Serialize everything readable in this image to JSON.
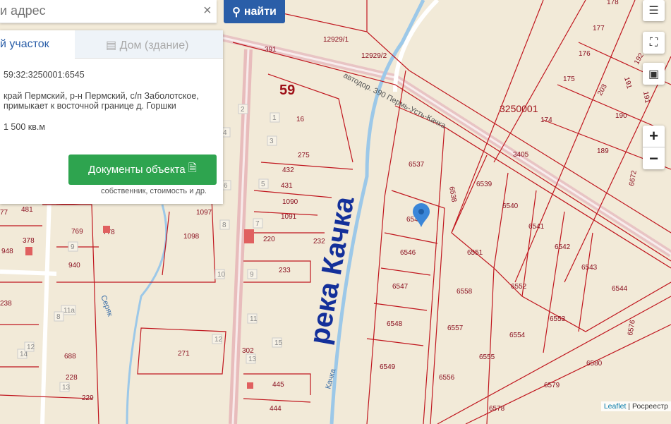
{
  "search": {
    "placeholder": "и адрес",
    "clear_icon": "×",
    "button_label": "найти"
  },
  "panel": {
    "tabs": [
      {
        "label": "й участок",
        "active": true
      },
      {
        "label": "Дом (здание)",
        "active": false
      }
    ],
    "cadastral_number": "59:32:3250001:6545",
    "address_line1": "край Пермский, р-н Пермский, с/п Заболотское,",
    "address_line2": "примыкает к восточной границе д. Горшки",
    "area": "1 500 кв.м",
    "documents_button": "Документы объекта",
    "documents_note": "собственник, стоимость и др."
  },
  "controls": {
    "zoom_in": "+",
    "zoom_out": "−"
  },
  "attribution": {
    "leaflet": "Leaflet",
    "source": "Росреестр"
  },
  "map": {
    "river_label": "река Качка",
    "river_small_label": "Качка",
    "stream_label": "Серяк",
    "road_label": "автодор. 390 Пермь-Усть-Качка",
    "quarter_label": "3250001",
    "district_label": "59",
    "parcels": [
      "16",
      "275",
      "432",
      "431",
      "1090",
      "1091",
      "1097",
      "1098",
      "220",
      "232",
      "233",
      "769",
      "778",
      "940",
      "271",
      "302",
      "445",
      "444",
      "688",
      "228",
      "229",
      "238",
      "948",
      "378",
      "481",
      "77",
      "391",
      "12929/1",
      "12929/2",
      "174",
      "175",
      "176",
      "177",
      "178",
      "203",
      "190",
      "189",
      "3405",
      "6537",
      "6538",
      "6539",
      "6540",
      "6541",
      "6542",
      "6543",
      "6544",
      "6545",
      "6546",
      "6551",
      "6547",
      "6558",
      "6552",
      "6553",
      "6548",
      "6557",
      "6554",
      "6555",
      "6549",
      "6556",
      "6580",
      "6579",
      "6578",
      "6576",
      "6672",
      "192",
      "191",
      "191"
    ],
    "house_numbers": [
      "1",
      "2",
      "3",
      "4",
      "5",
      "6",
      "7",
      "8",
      "9",
      "10",
      "11",
      "12",
      "13",
      "14",
      "15",
      "11а",
      "8",
      "12",
      "13",
      "9"
    ],
    "marker": "location-pin"
  }
}
